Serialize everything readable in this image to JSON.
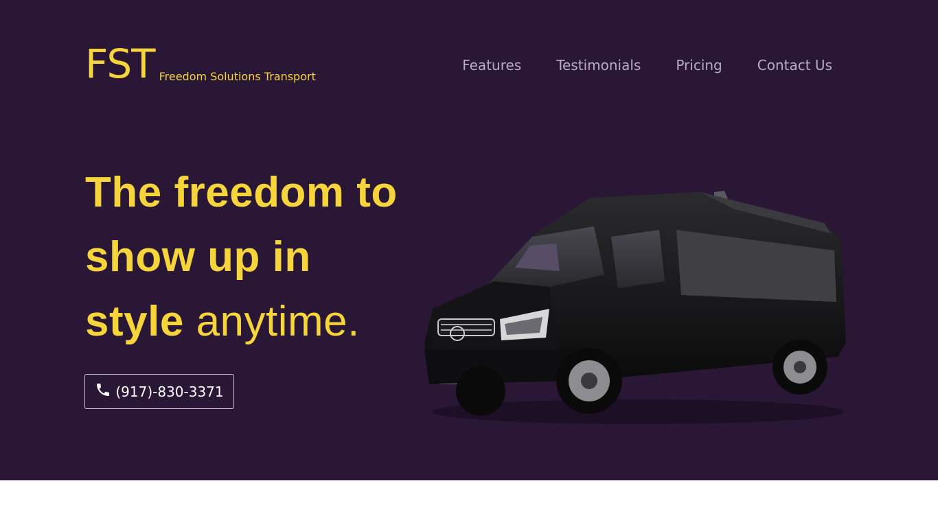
{
  "brand": {
    "mark": "FST",
    "name": "Freedom Solutions Transport"
  },
  "nav": {
    "items": [
      {
        "label": "Features"
      },
      {
        "label": "Testimonials"
      },
      {
        "label": "Pricing"
      },
      {
        "label": "Contact Us"
      }
    ]
  },
  "hero": {
    "headline_line1": "The freedom to",
    "headline_line2": "show up in",
    "headline_line3_bold": "style",
    "headline_line3_light": "anytime.",
    "phone_icon": "phone-icon",
    "phone_number": "(917)-830-3371",
    "image": "black-sprinter-van"
  },
  "colors": {
    "background": "#2a1736",
    "accent": "#f5d53b",
    "nav_text": "#b8adc2",
    "button_border": "#c9bfd2",
    "below_fold": "#ffffff"
  }
}
